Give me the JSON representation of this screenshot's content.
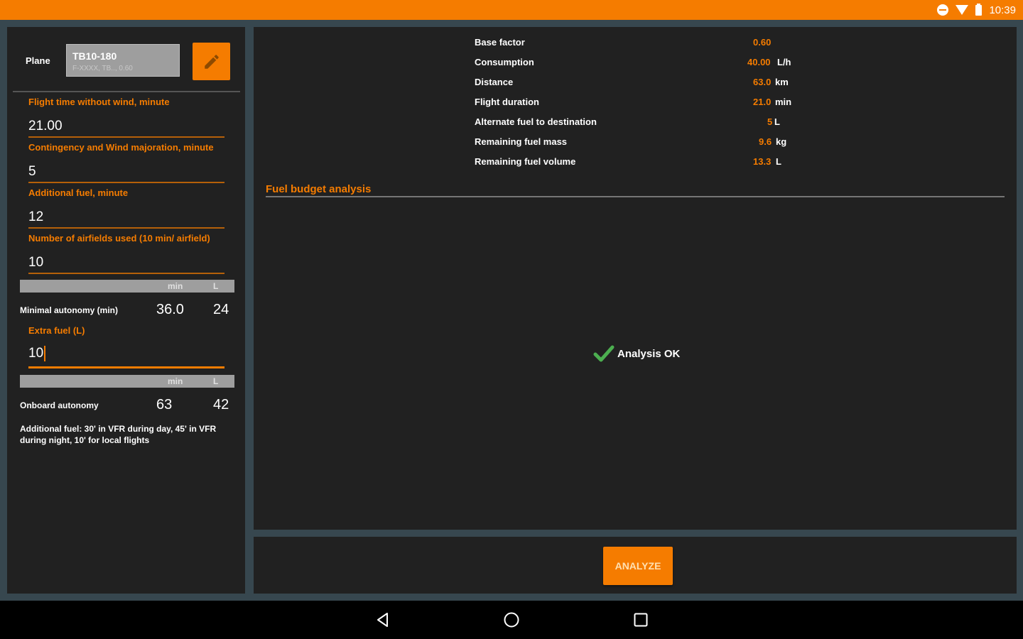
{
  "status_bar": {
    "time": "10:39",
    "icons": [
      "do-not-disturb-icon",
      "wifi-icon",
      "battery-icon"
    ],
    "background": "#f57c00"
  },
  "plane": {
    "label": "Plane",
    "name": "TB10-180",
    "subtitle": "F-XXXX, TB.., 0.60",
    "edit_icon": "pencil-icon"
  },
  "fields": [
    {
      "label": "Flight time without wind, minute",
      "value": "21.00"
    },
    {
      "label": "Contingency and Wind majoration, minute",
      "value": "5"
    },
    {
      "label": "Additional fuel, minute",
      "value": "12"
    },
    {
      "label": "Number of airfields used (10 min/ airfield)",
      "value": "10"
    }
  ],
  "units": {
    "min": "min",
    "l": "L"
  },
  "minimal_autonomy": {
    "label": "Minimal autonomy (min)",
    "min": "36.0",
    "l": "24"
  },
  "extra_fuel": {
    "label": "Extra fuel (L)",
    "value": "10"
  },
  "onboard_autonomy": {
    "label": "Onboard autonomy",
    "min": "63",
    "l": "42"
  },
  "note": "Additional fuel: 30' in VFR during day, 45' in VFR during night, 10' for local flights",
  "results": [
    {
      "name": "Base factor",
      "value": "0.60",
      "unit": ""
    },
    {
      "name": "Consumption",
      "value": "40.00",
      "unit": "L/h"
    },
    {
      "name": "Distance",
      "value": "63.0",
      "unit": "km"
    },
    {
      "name": "Flight duration",
      "value": "21.0",
      "unit": "min"
    },
    {
      "name": "Alternate fuel to destination",
      "value": "5",
      "unit": "L"
    },
    {
      "name": "Remaining fuel mass",
      "value": "9.6",
      "unit": "kg"
    },
    {
      "name": "Remaining fuel volume",
      "value": "13.3",
      "unit": "L"
    }
  ],
  "section_title": "Fuel budget analysis",
  "analysis": {
    "text": "Analysis OK",
    "icon": "checkmark-icon",
    "color": "#4caf50"
  },
  "analyze_button": "ANALYZE",
  "nav": {
    "back": "back-icon",
    "home": "home-icon",
    "recents": "recents-icon"
  },
  "accent": "#f57c00"
}
